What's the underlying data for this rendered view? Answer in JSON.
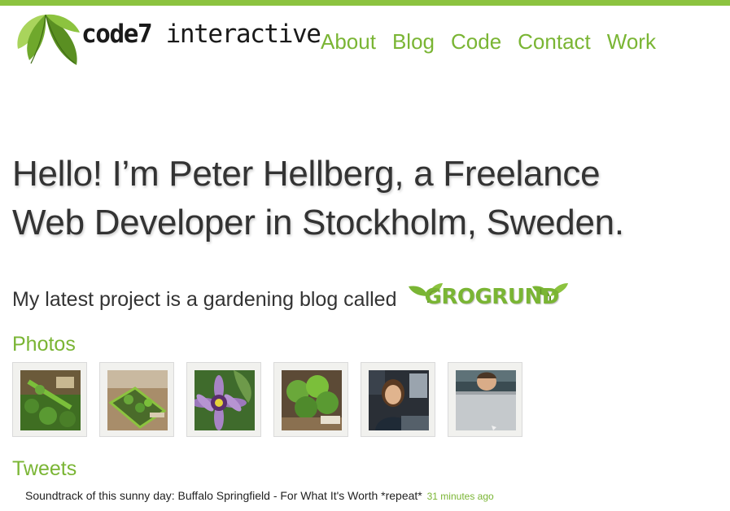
{
  "brand": {
    "name_bold": "code7",
    "name_rest": " interactive",
    "accent": "#8cc33f",
    "link_green": "#7ab534"
  },
  "nav": {
    "items": [
      {
        "label": "About"
      },
      {
        "label": "Blog"
      },
      {
        "label": "Code"
      },
      {
        "label": "Contact"
      },
      {
        "label": "Work"
      }
    ]
  },
  "hero": {
    "line1": "Hello! I’m Peter Hellberg, a Freelance",
    "line2": "Web Developer in Stockholm, Sweden."
  },
  "latest_project": {
    "text": "My latest project is a gardening blog called",
    "logo_text": "GROGRUND"
  },
  "photos": {
    "heading": "Photos",
    "items": [
      {
        "icon": "plant-seedlings-photo"
      },
      {
        "icon": "planter-box-photo"
      },
      {
        "icon": "passion-flower-photo"
      },
      {
        "icon": "potted-plant-photo"
      },
      {
        "icon": "person-at-desk-photo"
      },
      {
        "icon": "person-behind-monitor-photo"
      }
    ]
  },
  "tweets": {
    "heading": "Tweets",
    "items": [
      {
        "text": "Soundtrack of this sunny day: Buffalo Springfield - For What It's Worth *repeat*",
        "time": "31 minutes ago"
      }
    ]
  }
}
